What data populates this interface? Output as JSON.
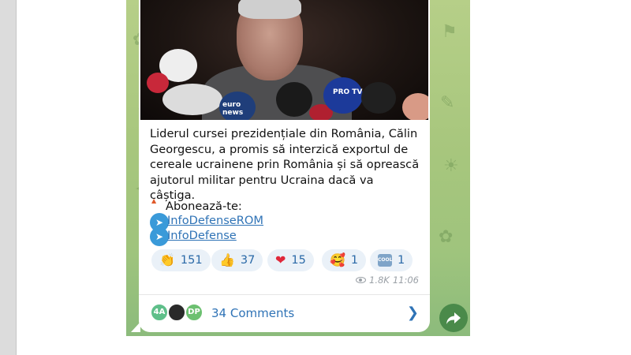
{
  "post": {
    "text": "Liderul cursei prezidențiale din România, Călin Georgescu, a promis să interzică exportul de cereale ucrainene prin România și să oprească ajutorul militar pentru Ucraina dacă va câștiga.",
    "subscribe_label": "Abonează-te:",
    "links": [
      "InfoDefenseROM",
      "InfoDefense"
    ],
    "photo_mic_labels": [
      "euro news",
      "PRO TV"
    ]
  },
  "reactions": [
    {
      "icon": "clapping-hands-icon",
      "emoji": "👏",
      "count": "151"
    },
    {
      "icon": "thumbs-up-icon",
      "emoji": "👍",
      "count": "37"
    },
    {
      "icon": "red-heart-icon",
      "emoji": "❤",
      "count": "15"
    },
    {
      "icon": "smiling-face-hearts-icon",
      "emoji": "🥰",
      "count": "1"
    },
    {
      "icon": "cool-button-icon",
      "emoji": "COOL",
      "count": "1"
    }
  ],
  "meta": {
    "views": "1.8K",
    "time": "11:06"
  },
  "comments": {
    "avatars": [
      {
        "label": "4A",
        "color": "#5fbf8a"
      },
      {
        "label": "",
        "color": "#2a2a2a"
      },
      {
        "label": "DP",
        "color": "#6cc070"
      }
    ],
    "label": "34 Comments"
  }
}
